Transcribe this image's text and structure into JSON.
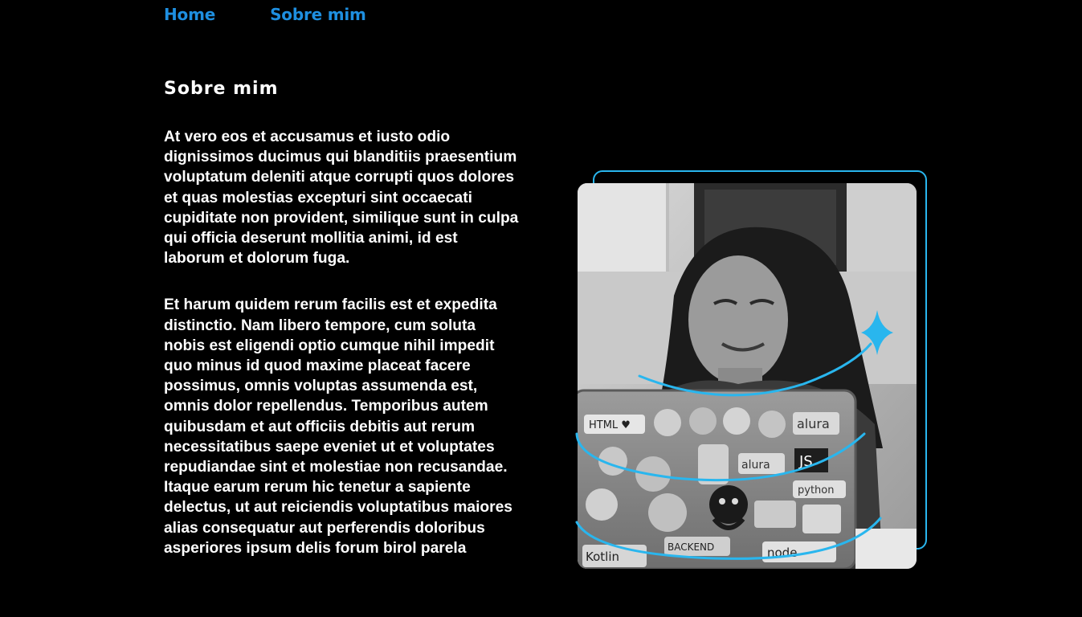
{
  "nav": {
    "home": "Home",
    "about": "Sobre mim"
  },
  "section": {
    "title": "Sobre mim",
    "paragraphs": [
      "At vero eos et accusamus et iusto odio dignissimos ducimus qui blanditiis praesentium voluptatum deleniti atque corrupti quos dolores et quas molestias excepturi sint occaecati cupiditate non provident, similique sunt in culpa qui officia deserunt mollitia animi, id est laborum et dolorum fuga.",
      "Et harum quidem rerum facilis est et expedita distinctio. Nam libero tempore, cum soluta nobis est eligendi optio cumque nihil impedit quo minus id quod maxime placeat facere possimus, omnis voluptas assumenda est, omnis dolor repellendus. Temporibus autem quibusdam et aut officiis debitis aut rerum necessitatibus saepe eveniet ut et voluptates repudiandae sint et molestiae non recusandae. Itaque earum rerum hic tenetur a sapiente delectus, ut aut reiciendis voluptatibus maiores alias consequatur aut perferendis doloribus asperiores ipsum delis forum birol parela"
    ]
  },
  "photo": {
    "sticker_texts": [
      "HTML ♥",
      "alura",
      "JS",
      "python",
      "alura",
      "BACKEND",
      "node",
      "Kotlin"
    ]
  },
  "colors": {
    "background": "#000000",
    "nav_link": "#1e8fe0",
    "accent": "#29b6ee",
    "text": "#ffffff"
  },
  "icons": {
    "sparkle": "sparkle-icon",
    "github": "github-octocat-icon"
  }
}
